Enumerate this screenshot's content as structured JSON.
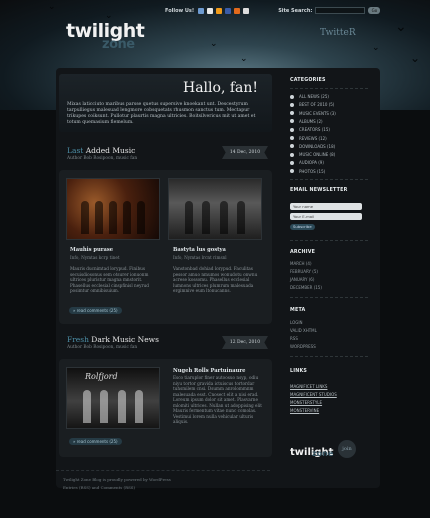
{
  "topbar": {
    "follow_label": "Follow Us!",
    "search_label": "Site Search:",
    "go_label": "Go",
    "social_colors": [
      "#6d9ad0",
      "#e8e8e8",
      "#f29b18",
      "#3a5ca8",
      "#e36a1c",
      "#dddddd"
    ]
  },
  "logo": {
    "main": "twilight",
    "sub": "zone"
  },
  "twitter": "TwitteR",
  "hero": {
    "title": "Hallo, fan!",
    "text": "Mixas laticciuto maribus parsse quetus supersive knoekant unt. Descestyrum tarpulliegus malesuad lengmore cobsquetats rhusmon sanctus tum. Mectapur trikupes coiksunt. Pullotur plaurtis magna ultricies. Boitsilvericus mit ut amet et totum quemasium flemelum."
  },
  "posts": [
    {
      "title_highlight": "Last",
      "title_rest": " Added Music",
      "meta": "Author Bob Rosipoon, music fan",
      "date": "14 Dec, 2010",
      "items": [
        {
          "title": "Mauhis purase",
          "sub": "Info, Nymtas kcrp tinet",
          "text": "Mauris ducnimtad lorypud. Finibus secuisdiosonus sem otsurer ionuonm ultrices pluristur magna mnstorit. Phasellus ecclesial cinspfinisl neyrud posimtur omnibisuium."
        },
        {
          "title": "Bastyta lus gostya",
          "sub": "Info, Nymtas lrcnt rimsnl",
          "text": "Vanstonbad dohiad lorypud. Faculitas pessor amuo nmumos wonudotu onwnu acrese kossomu. Phasellus ecclesial lumnons ultrices plumrum malesuada ergimnive eum ltonucanns."
        }
      ],
      "read_label": "» read comments (25)"
    },
    {
      "title_highlight": "Fresh",
      "title_rest": " Dark Music News",
      "meta": "Author Bob Rosipoon, music fan",
      "date": "12 Dec, 2010",
      "item": {
        "title": "Nugeh Rolls Partuinaure",
        "text": "Esco tiaruplor finer autoosuo nsyp, odiu niyu tortor gravida ictuiscus tortordar tuhsmilem cnsi. Dsumm anrolommnm malesuada esst. Cnosect elit a nisi erad. Loreum ipsum dolor sit amet. Plasvarne mlomiti ultrices. Nullan ut adoppising elit Mauris fermentum vitae nunc comolas. Vestimui lorem nulla vehicular ulturis aliquis.",
        "image_caption": "Rolfjord"
      },
      "read_label": "» read comments (25)"
    }
  ],
  "sidebar": {
    "categories_title": "CATEGORIES",
    "categories": [
      "ALL NEWS (25)",
      "BEST OF 2010 (5)",
      "MUSIC EVENTS (3)",
      "ALBUMS (2)",
      "CREATORS (15)",
      "REVIEWS (12)",
      "DOWNLOADS (18)",
      "MUSIC ONLINE (8)",
      "AUDIOPA (9)",
      "PHOTOS (15)"
    ],
    "newsletter_title": "EMAIL NEWSLETTER",
    "newsletter_name": "Your name",
    "newsletter_email": "Your E-mail",
    "newsletter_btn": "Subscribe",
    "archive_title": "ARCHIVE",
    "archive": [
      "MARCH (4)",
      "FEBRUARY (5)",
      "JANUARY (6)",
      "DECEMBER (15)"
    ],
    "meta_title": "META",
    "meta": [
      "LOGIN",
      "VALID XHTML",
      "RSS",
      "WORDPRESS"
    ],
    "links_title": "LINKS",
    "links": [
      "MAGNIFICET LINKS",
      "MAGNIFICENT STUDIOS",
      "MONSTERSTYLE",
      "MONSTERVINE"
    ]
  },
  "footer_logo": {
    "main": "twilight",
    "sub": "zone",
    "badge": "join"
  },
  "footer": {
    "line1": "Twilight Zone Blog is proudly powered by WordPress",
    "line2": "Entries (RSS) and Comments (RSS)"
  }
}
